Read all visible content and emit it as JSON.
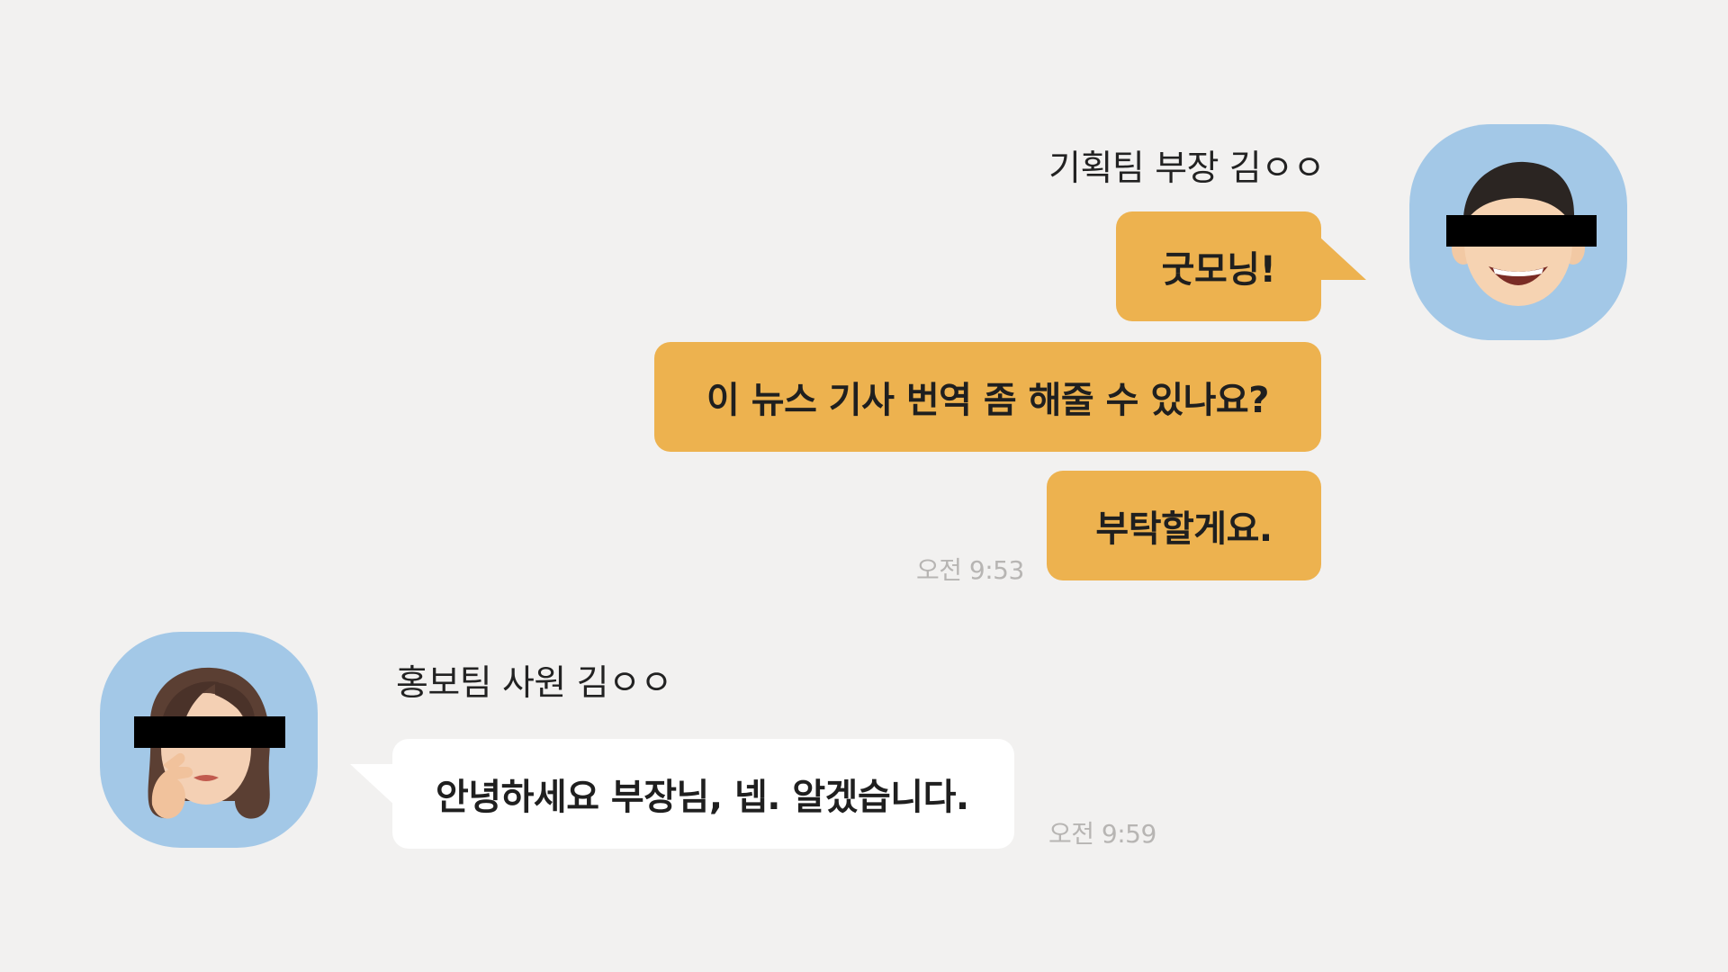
{
  "sender": {
    "name": "기획팀 부장 김ㅇㅇ",
    "bubble_color": "#edb24f",
    "avatar_bg": "#a3c8e7",
    "messages": [
      "굿모닝!",
      "이 뉴스 기사 번역 좀 해줄 수 있나요?",
      "부탁할게요."
    ],
    "time": "오전 9:53"
  },
  "receiver": {
    "name": "홍보팀 사원 김ㅇㅇ",
    "bubble_color": "#ffffff",
    "avatar_bg": "#a3c8e7",
    "messages": [
      "안녕하세요 부장님, 넵. 알겠습니다."
    ],
    "time": "오전 9:59"
  },
  "background": "#f2f1f0"
}
